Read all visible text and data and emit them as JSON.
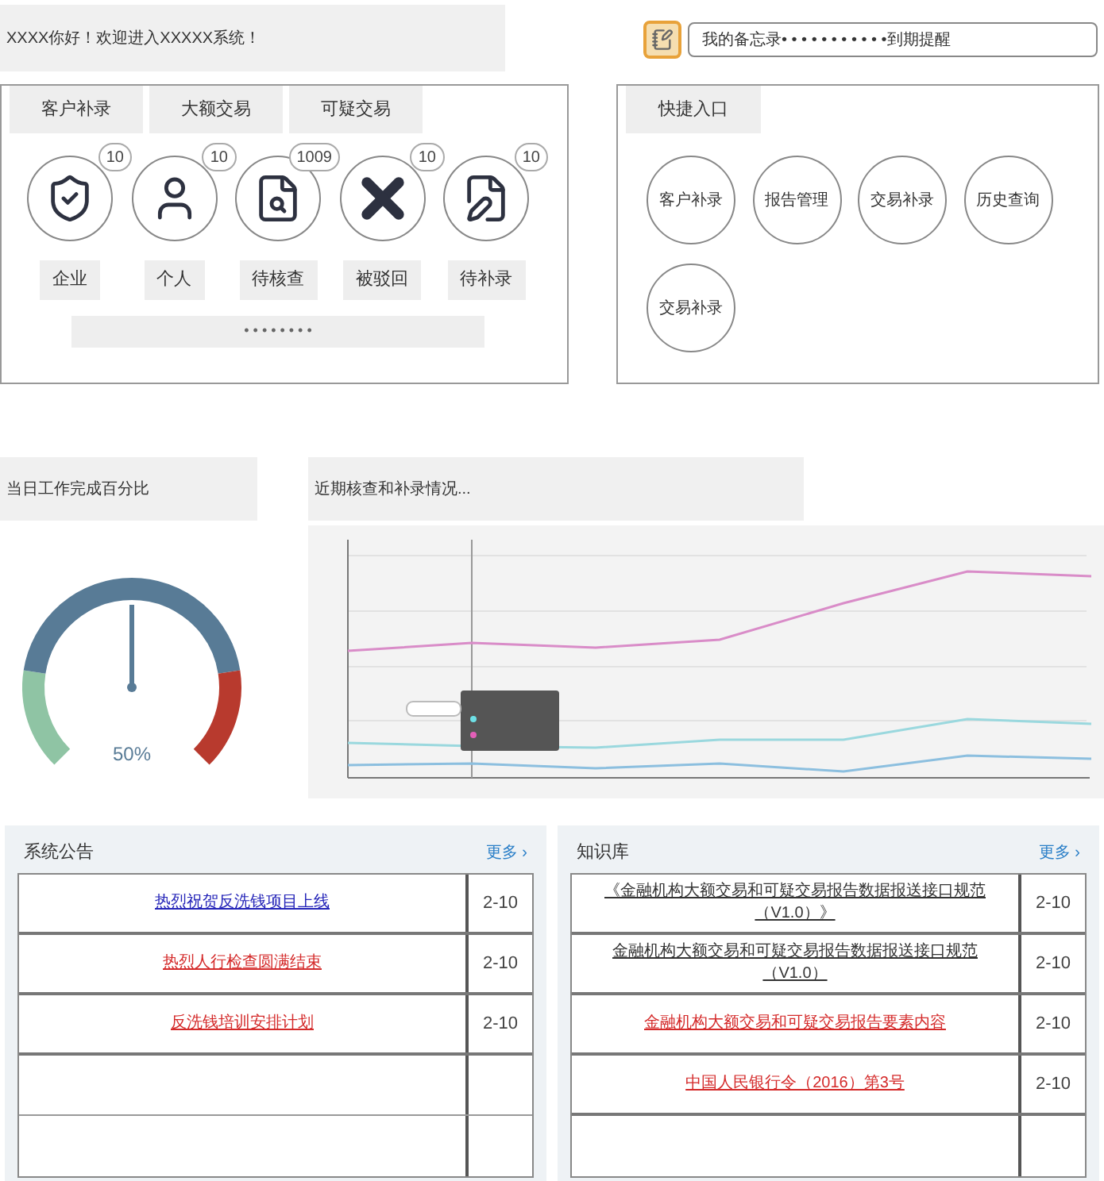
{
  "greeting": "XXXX你好！欢迎进入XXXXX系统！",
  "memo": {
    "text": "我的备忘录• • • • • • • • • • •到期提醒"
  },
  "tasks": {
    "tabs": [
      "客户补录",
      "大额交易",
      "可疑交易"
    ],
    "items": [
      {
        "kind": "shield",
        "label": "企业",
        "count": "10"
      },
      {
        "kind": "person",
        "label": "个人",
        "count": "10"
      },
      {
        "kind": "search",
        "label": "待核查",
        "count": "1009"
      },
      {
        "kind": "reject",
        "label": "被驳回",
        "count": "10"
      },
      {
        "kind": "edit",
        "label": "待补录",
        "count": "10"
      }
    ],
    "pager": "• • • • • • • •"
  },
  "shortcuts": {
    "title": "快捷入口",
    "items": [
      "客户补录",
      "报告管理",
      "交易补录",
      "历史查询",
      "交易补录"
    ]
  },
  "gauge": {
    "title": "当日工作完成百分比",
    "level": 0.5,
    "reading": "50%"
  },
  "trend": {
    "title": "近期核查和补录情况..."
  },
  "notices": {
    "title": "系统公告",
    "more": "更多 ›",
    "rows": [
      {
        "title": "热烈祝贺反洗钱项目上线",
        "date": "2-10",
        "color": "#2424b8"
      },
      {
        "title": "热烈人行检查圆满结束",
        "date": "2-10",
        "color": "#d42a2a"
      },
      {
        "title": "反洗钱培训安排计划",
        "date": "2-10",
        "color": "#d42a2a"
      }
    ]
  },
  "knowledge": {
    "title": "知识库",
    "more": "更多 ›",
    "rows": [
      {
        "title": "《金融机构大额交易和可疑交易报告数据报送接口规范（V1.0）》",
        "date": "2-10",
        "color": "#333333"
      },
      {
        "title": "金融机构大额交易和可疑交易报告数据报送接口规范（V1.0）",
        "date": "2-10",
        "color": "#333333"
      },
      {
        "title": "金融机构大额交易和可疑交易报告要素内容",
        "date": "2-10",
        "color": "#d42a2a"
      },
      {
        "title": "中国人民银行令（2016）第3号",
        "date": "2-10",
        "color": "#d42a2a"
      }
    ]
  }
}
